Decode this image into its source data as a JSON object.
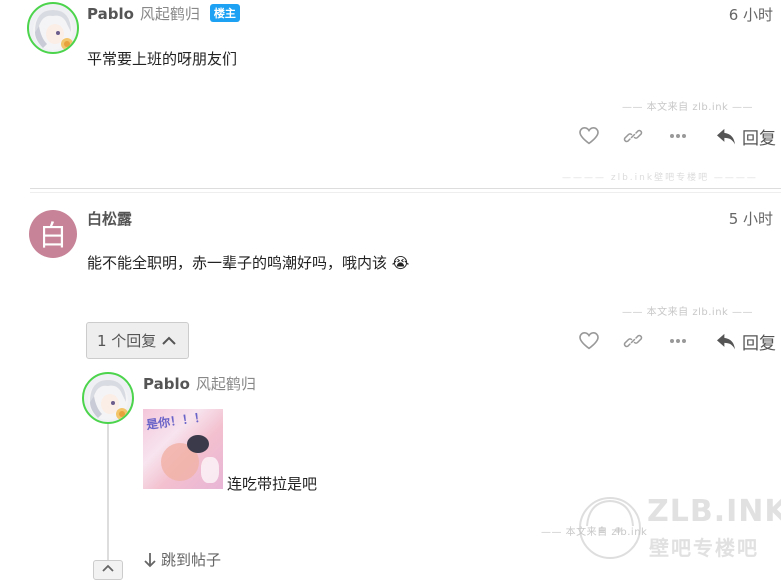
{
  "posts": [
    {
      "username": "Pablo",
      "alias": "风起鹤归",
      "badge": "楼主",
      "time": "6 小时",
      "content": "平常要上班的呀朋友们",
      "watermark": "—— 本文来自 zlb.ink ——",
      "reply_label": "回复"
    },
    {
      "username": "白松露",
      "avatar_letter": "白",
      "avatar_color": "#c78397",
      "time": "5 小时",
      "content": "能不能全职明，赤一辈子的鸣潮好吗，哦内该",
      "emoji": "😭",
      "watermark": "—— 本文来自 zlb.ink ——",
      "reply_label": "回复",
      "replies_count_label": "1 个回复"
    }
  ],
  "separator_watermark": "———— zlb.ink壁吧专楼吧 ————",
  "nested_reply": {
    "username": "Pablo",
    "alias": "风起鹤归",
    "sticker_text": "是你！！！",
    "content": "连吃带拉是吧",
    "watermark": "—— 本文来自 zlb.ink",
    "jump_label": "跳到帖子"
  },
  "site_logo": {
    "title": "ZLB.INK",
    "subtitle": "壁吧专楼吧"
  },
  "colors": {
    "online_ring": "#4cd44c",
    "badge_bg": "#1da1f2"
  }
}
